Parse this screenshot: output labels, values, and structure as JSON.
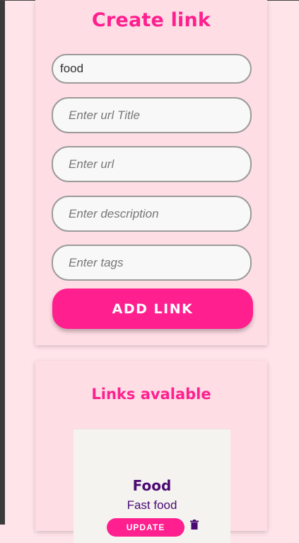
{
  "create_form": {
    "title": "Create link",
    "fields": {
      "name_value": "food",
      "title_placeholder": "Enter url Title",
      "url_placeholder": "Enter url",
      "description_placeholder": "Enter description",
      "tags_placeholder": "Enter tags"
    },
    "add_button_label": "ADD LINK"
  },
  "links_section": {
    "title": "Links avalable",
    "items": [
      {
        "title": "Food",
        "description": "Fast food",
        "update_label": "UPDATE",
        "delete_icon": "trash-icon"
      }
    ]
  },
  "colors": {
    "accent": "#ff1f8e",
    "background": "#ffe4ea",
    "card": "#ffdde5",
    "link_text": "#4a0a73"
  }
}
